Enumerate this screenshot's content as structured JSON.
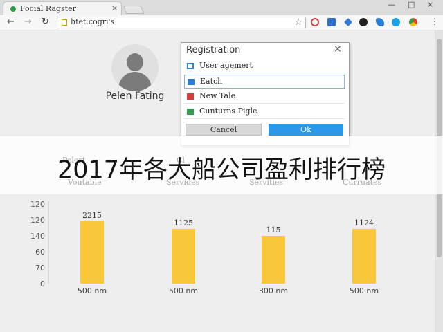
{
  "browser": {
    "tab_title": "Focial Ragster",
    "tab_close": "×",
    "url": "htet.cogri's",
    "window_controls": {
      "minimize": "—",
      "maximize": "□",
      "close": "×"
    },
    "nav_icons": [
      "back-arrow-icon",
      "forward-arrow-icon",
      "reload-icon"
    ],
    "extension_icons": [
      {
        "name": "red-ring-extension-icon",
        "color": "#d64040"
      },
      {
        "name": "blue-square-extension-icon",
        "color": "#2f6fc8"
      },
      {
        "name": "arrow-extension-icon",
        "color": "#3a7bd5"
      },
      {
        "name": "dark-circle-extension-icon",
        "color": "#222222"
      },
      {
        "name": "phone-extension-icon",
        "color": "#2a7fd4"
      },
      {
        "name": "skype-extension-icon",
        "color": "#1aa0e6"
      },
      {
        "name": "chrome-extension-icon",
        "color": "#e0452f"
      }
    ],
    "menu_glyph": "⋮"
  },
  "profile": {
    "name": "Pelen Fating"
  },
  "dialog": {
    "title": "Registration",
    "close": "×",
    "items": [
      {
        "label": "User agemert",
        "icon": "user-management-icon",
        "icon_color": "#2f7fd6"
      },
      {
        "label": "Eatch",
        "icon": "edit-icon",
        "icon_color": "#2a7fd4",
        "selected": true
      },
      {
        "label": "New Tale",
        "icon": "new-table-icon",
        "icon_color": "#d63c3c"
      },
      {
        "label": "Cunturns Pigle",
        "icon": "contacts-icon",
        "icon_color": "#2f9e4c"
      }
    ],
    "cancel_label": "Cancel",
    "ok_label": "Ok"
  },
  "overlay": {
    "caption": "2017年各大船公司盈利排行榜",
    "ghost_labels": [
      "Pelert",
      "Voutable",
      "Cl",
      "Servides",
      "Servities",
      "Curruates"
    ]
  },
  "chart_data": {
    "type": "bar",
    "y_ticks": [
      "120",
      "120",
      "140",
      "60",
      "70",
      "0"
    ],
    "categories": [
      "500 nm",
      "500 nm",
      "300 nm",
      "500 nm"
    ],
    "values": [
      2215,
      1125,
      115,
      1124
    ],
    "value_labels": [
      "2215",
      "1125",
      "115",
      "1124"
    ],
    "bar_color": "#f9c83a"
  }
}
